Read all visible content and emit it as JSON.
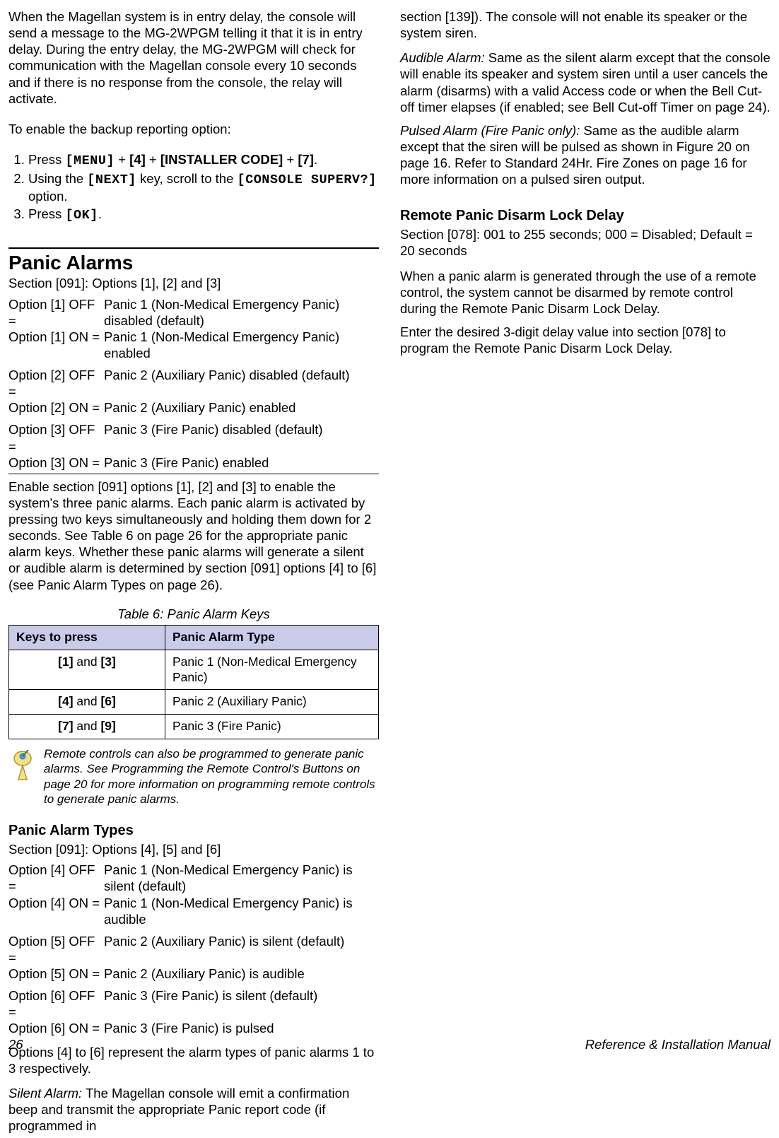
{
  "left": {
    "intro": "When the Magellan system is in entry delay, the console will send a message to the MG-2WPGM telling it that it is in entry delay. During the entry delay, the MG-2WPGM will check for communication with the Magellan console every 10 seconds and if there is no response from the console, the relay will activate.",
    "enable_line": "To enable the backup reporting option:",
    "steps": {
      "s1a": "Press ",
      "s1b": "[MENU]",
      "plus": " + ",
      "s1c": "[4]",
      "s1d": "[INSTALLER CODE]",
      "s1e": "[7]",
      "s1f": ".",
      "s2a": "Using the ",
      "s2b": "[NEXT]",
      "s2c": " key, scroll to the ",
      "s2d": "[CONSOLE SUPERV?]",
      "s2e": " option.",
      "s3a": "Press ",
      "s3b": "[OK]",
      "s3c": "."
    },
    "panic_heading": "Panic Alarms",
    "panic_sec": "Section [091]: Options [1], [2] and [3]",
    "opt1_off_l": "Option [1] OFF =",
    "opt1_off_v": "Panic 1 (Non-Medical Emergency Panic) disabled (default)",
    "opt1_on_l": "Option [1] ON =",
    "opt1_on_v": "Panic 1 (Non-Medical Emergency Panic) enabled",
    "opt2_off_l": "Option [2] OFF =",
    "opt2_off_v": "Panic 2 (Auxiliary Panic) disabled (default)",
    "opt2_on_l": "Option [2] ON =",
    "opt2_on_v": "Panic 2 (Auxiliary Panic) enabled",
    "opt3_off_l": "Option [3] OFF =",
    "opt3_off_v": "Panic 3 (Fire Panic) disabled (default)",
    "opt3_on_l": "Option [3] ON =",
    "opt3_on_v": "Panic 3 (Fire Panic) enabled",
    "panic_para": "Enable section [091] options [1], [2] and [3] to enable the system's three panic alarms. Each panic alarm is activated by pressing two keys simultaneously and holding them down for 2 seconds. See Table 6 on page 26 for the appropriate panic alarm keys. Whether these panic alarms will generate a silent or audible alarm is determined by section [091] options [4] to [6] (see Panic Alarm Types on page 26).",
    "table_caption": "Table 6: Panic Alarm Keys",
    "th1": "Keys to press",
    "th2": "Panic Alarm Type",
    "r1a1": "[1]",
    "r1and": " and ",
    "r1a2": "[3]",
    "r1b": "Panic 1 (Non-Medical Emergency Panic)",
    "r2a1": "[4]",
    "r2a2": "[6]",
    "r2b": "Panic 2 (Auxiliary Panic)",
    "r3a1": "[7]",
    "r3a2": "[9]",
    "r3b": "Panic 3 (Fire Panic)",
    "note": "Remote controls can also be programmed to generate panic alarms. See Programming the Remote Control's Buttons on page 20 for more information on programming remote controls to generate panic alarms.",
    "types_heading": "Panic Alarm Types",
    "types_sec": "Section [091]: Options [4], [5] and [6]",
    "t4_off_l": "Option [4] OFF =",
    "t4_off_v": "Panic 1 (Non-Medical Emergency Panic) is silent (default)",
    "t4_on_l": "Option [4] ON =",
    "t4_on_v": "Panic 1 (Non-Medical Emergency Panic) is audible",
    "t5_off_l": "Option [5] OFF =",
    "t5_off_v": "Panic 2 (Auxiliary Panic) is silent (default)",
    "t5_on_l": "Option [5] ON =",
    "t5_on_v": "Panic 2 (Auxiliary Panic) is audible",
    "t6_off_l": "Option [6] OFF =",
    "t6_off_v": "Panic 3 (Fire Panic) is silent (default)",
    "t6_on_l": "Option [6] ON =",
    "t6_on_v": "Panic 3 (Fire Panic) is pulsed",
    "types_para": "Options [4] to [6] represent the alarm types of panic alarms 1 to 3 respectively.",
    "silent_label": "Silent Alarm:",
    "silent_text": " The Magellan console will emit a confirmation beep and transmit the appropriate Panic report code (if programmed in"
  },
  "right": {
    "cont": "section [139]). The console will not enable its speaker or the system siren.",
    "audible_label": "Audible Alarm:",
    "audible_text": " Same as the silent alarm except that the console will enable its speaker and system siren until a user cancels the alarm (disarms) with a valid Access code or when the Bell Cut-off timer elapses (if enabled; see Bell Cut-off Timer on page 24).",
    "pulsed_label": "Pulsed Alarm (Fire Panic only):",
    "pulsed_text": " Same as the audible alarm except that the siren will be pulsed as shown in Figure 20 on page 16. Refer to Standard 24Hr. Fire Zones on page 16 for more information on a pulsed siren output.",
    "remote_heading": "Remote Panic Disarm Lock Delay",
    "remote_sec": "Section [078]: 001 to 255 seconds; 000 = Disabled; Default = 20 seconds",
    "remote_p1": "When a panic alarm is generated through the use of a remote control, the system cannot be disarmed by remote control during the Remote Panic Disarm Lock Delay.",
    "remote_p2": "Enter the desired 3-digit delay value into section [078] to program the Remote Panic Disarm Lock Delay."
  },
  "footer": {
    "page": "26",
    "title": "Reference & Installation Manual"
  }
}
